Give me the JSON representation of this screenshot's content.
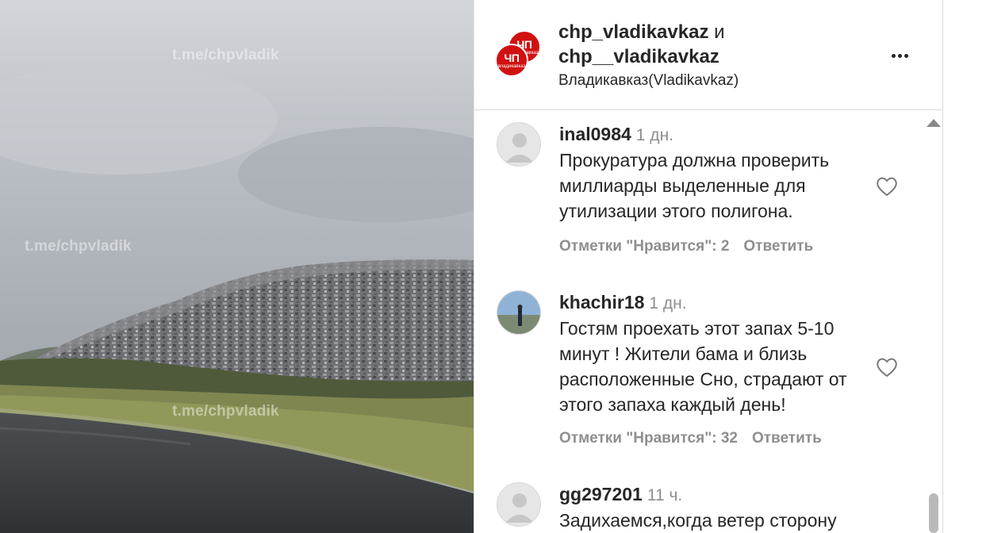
{
  "post": {
    "watermarks": [
      "t.me/chpvladik",
      "t.me/chpvladik",
      "t.me/chpvladik"
    ]
  },
  "header": {
    "account1": "chp_vladikavkaz",
    "and_word": "и",
    "account2": "chp__vladikavkaz",
    "location": "Владикавказ(Vladikavkaz)",
    "logo_text": "ЧП",
    "logo_subtext": "владикавказ",
    "brand_color": "#d11111"
  },
  "comments": [
    {
      "username": "inal0984",
      "time": "1 дн.",
      "text": "Прокуратура должна проверить миллиарды выделенные для утилизации этого полигона.",
      "likes_text": "Отметки \"Нравится\": 2",
      "reply_label": "Ответить",
      "avatar": "default-avatar-icon"
    },
    {
      "username": "khachir18",
      "time": "1 дн.",
      "text": "Гостям проехать этот запах 5-10 минут ! Жители бама и близь расположенные Сно, страдают от этого запаха каждый день!",
      "likes_text": "Отметки \"Нравится\": 32",
      "reply_label": "Ответить",
      "avatar": "photo-avatar"
    },
    {
      "username": "gg297201",
      "time": "11 ч.",
      "text": "Задихаемся,когда ветер сторону",
      "avatar": "default-avatar-icon"
    }
  ]
}
